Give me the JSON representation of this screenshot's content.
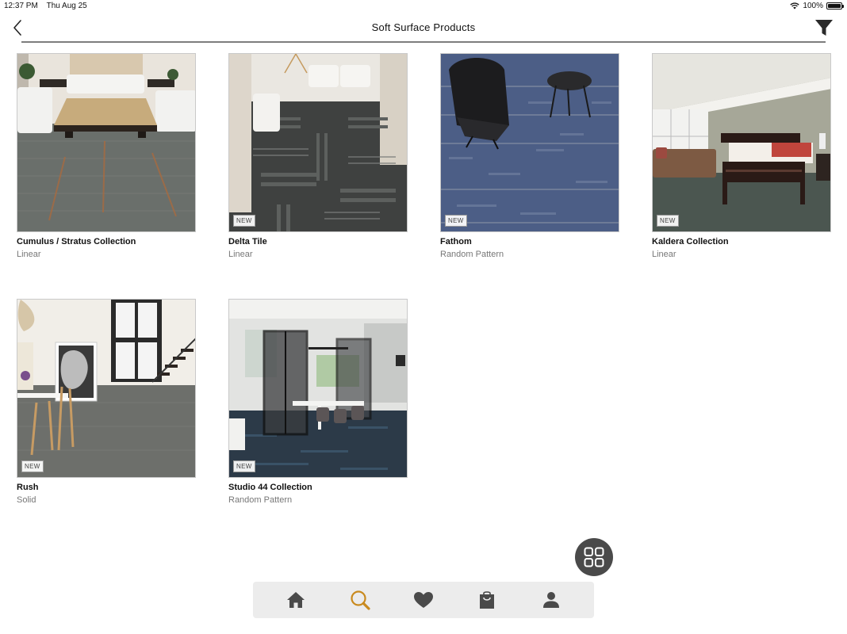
{
  "status_bar": {
    "time": "12:37 PM",
    "date": "Thu Aug 25",
    "battery": "100%"
  },
  "nav": {
    "title": "Soft Surface Products"
  },
  "products": [
    {
      "name": "Cumulus / Stratus Collection",
      "pattern": "Linear",
      "badge": ""
    },
    {
      "name": "Delta Tile",
      "pattern": "Linear",
      "badge": "NEW"
    },
    {
      "name": "Fathom",
      "pattern": "Random Pattern",
      "badge": "NEW"
    },
    {
      "name": "Kaldera Collection",
      "pattern": "Linear",
      "badge": "NEW"
    },
    {
      "name": "Rush",
      "pattern": "Solid",
      "badge": "NEW"
    },
    {
      "name": "Studio 44 Collection",
      "pattern": "Random Pattern",
      "badge": "NEW"
    }
  ],
  "tab_bar": {
    "tabs": [
      {
        "icon": "home-icon"
      },
      {
        "icon": "search-icon",
        "active": true
      },
      {
        "icon": "heart-icon"
      },
      {
        "icon": "shopping-bag-icon"
      },
      {
        "icon": "user-icon"
      }
    ]
  },
  "colors": {
    "accent": "#c98a1e",
    "icon": "#4a4a4a",
    "tab_bar_bg": "#ececec"
  }
}
